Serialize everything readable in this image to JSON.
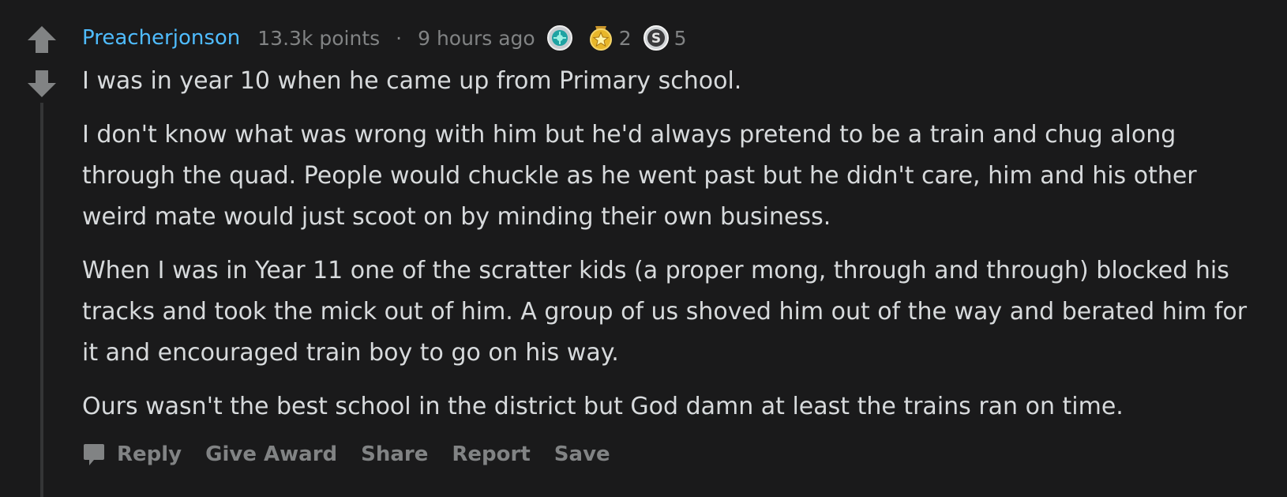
{
  "comment": {
    "author": "Preacherjonson",
    "points": "13.3k points",
    "separator": "·",
    "time": "9 hours ago",
    "awards": [
      {
        "icon": "silver-award-icon",
        "count": ""
      },
      {
        "icon": "gold-star-award-icon",
        "count": "2"
      },
      {
        "icon": "silver-s-award-icon",
        "count": "5"
      }
    ],
    "paragraphs": [
      "I was in year 10 when he came up from Primary school.",
      "I don't know what was wrong with him but he'd always pretend to be a train and chug along through the quad. People would chuckle as he went past but he didn't care, him and his other weird mate would just scoot on by minding their own business.",
      "When I was in Year 11 one of the scratter kids (a proper mong, through and through) blocked his tracks and took the mick out of him. A group of us shoved him out of the way and berated him for it and encouraged train boy to go on his way.",
      "Ours wasn't the best school in the district but God damn at least the trains ran on time."
    ]
  },
  "actions": {
    "reply": "Reply",
    "give_award": "Give Award",
    "share": "Share",
    "report": "Report",
    "save": "Save"
  },
  "colors": {
    "background": "#1a1a1b",
    "author": "#4fbcff",
    "text": "#d7dadc",
    "muted": "#818384"
  }
}
